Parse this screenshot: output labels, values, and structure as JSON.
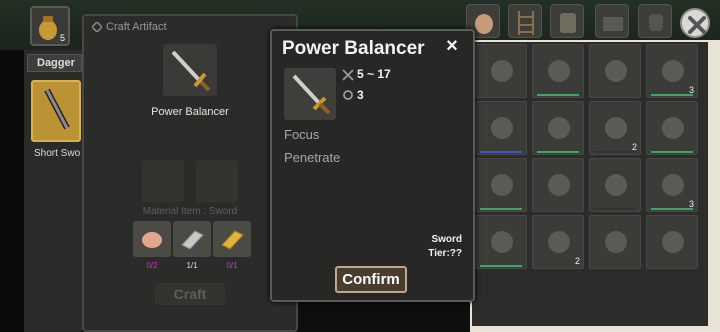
{
  "top_slot": {
    "count": "5"
  },
  "left": {
    "tab_label": "Dagger",
    "item_label": "Short Swo"
  },
  "craft": {
    "title": "Craft Artifact",
    "item_name": "Power Balancer",
    "material_caption": "Material Item : Sword",
    "materials": [
      {
        "name": "ore-pink",
        "count": "0/2",
        "color": "#c13dc5"
      },
      {
        "name": "ingot-silver",
        "count": "1/1",
        "color": "#dcdcdc"
      },
      {
        "name": "ingot-gold",
        "count": "0/1",
        "color": "#c13dc5"
      }
    ],
    "button_label": "Craft"
  },
  "popup": {
    "title": "Power Balancer",
    "close_glyph": "×",
    "damage": "5 ~ 17",
    "level": "3",
    "traits": [
      "Focus",
      "Penetrate"
    ],
    "type_line1": "Sword",
    "type_line2": "Tier:??",
    "confirm_label": "Confirm"
  },
  "inventory": {
    "quantities": [
      "",
      "",
      "",
      "3",
      "",
      "",
      "2",
      "",
      "",
      "",
      "",
      "3",
      "",
      "2",
      "",
      ""
    ],
    "bar_colors": [
      "",
      "#3aa860",
      "",
      "#3aa860",
      "#3a5ac0",
      "#3aa860",
      "#333333",
      "#3aa860",
      "#3aa860",
      "",
      "#333333",
      "#3aa860",
      "#3aa860",
      "",
      ""
    ]
  }
}
